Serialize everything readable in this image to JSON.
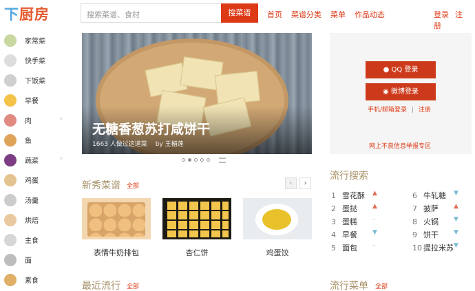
{
  "header": {
    "logo_part1": "下",
    "logo_part2": "厨房",
    "search_placeholder": "搜索菜谱、食材",
    "search_button": "搜菜谱",
    "nav": [
      "首页",
      "菜谱分类",
      "菜单",
      "作品动态"
    ],
    "login": "登录",
    "register": "注册"
  },
  "sidebar": {
    "items": [
      {
        "label": "家常菜",
        "icon": "dish-icon",
        "color": "#c9d8a0",
        "arrow": false
      },
      {
        "label": "快手菜",
        "icon": "clock-icon",
        "color": "#dddddd",
        "arrow": false
      },
      {
        "label": "下饭菜",
        "icon": "pot-icon",
        "color": "#cfcfcf",
        "arrow": false
      },
      {
        "label": "早餐",
        "icon": "sun-icon",
        "color": "#f3c34a",
        "arrow": false
      },
      {
        "label": "肉",
        "icon": "pig-icon",
        "color": "#e08a82",
        "arrow": true
      },
      {
        "label": "鱼",
        "icon": "fish-icon",
        "color": "#e0a35a",
        "arrow": false
      },
      {
        "label": "蔬菜",
        "icon": "eggplant-icon",
        "color": "#7d3d84",
        "arrow": true
      },
      {
        "label": "鸡蛋",
        "icon": "egg-icon",
        "color": "#e4c391",
        "arrow": false
      },
      {
        "label": "汤羹",
        "icon": "soup-bowl-icon",
        "color": "#cccccc",
        "arrow": false
      },
      {
        "label": "烘焙",
        "icon": "cookie-icon",
        "color": "#e8c9a0",
        "arrow": false
      },
      {
        "label": "主食",
        "icon": "rice-bowl-icon",
        "color": "#d6d6d6",
        "arrow": false
      },
      {
        "label": "面",
        "icon": "noodle-bowl-icon",
        "color": "#bdbdbd",
        "arrow": false
      },
      {
        "label": "素食",
        "icon": "wheat-icon",
        "color": "#e0b069",
        "arrow": false
      }
    ]
  },
  "hero": {
    "title": "无糖香葱苏打咸饼干",
    "made_count": "1663 人做过这道菜",
    "author": "by 王楣莲",
    "slide_count": 5,
    "active_slide": 2
  },
  "new_recipes": {
    "title": "新秀菜谱",
    "all_link": "全部",
    "prev": "‹",
    "next": "›",
    "items": [
      {
        "caption": "表情牛奶排包"
      },
      {
        "caption": "杏仁饼"
      },
      {
        "caption": "鸡蛋饺"
      }
    ]
  },
  "recent": {
    "title": "最近流行",
    "all_link": "全部"
  },
  "login_panel": {
    "qq_login": "QQ 登录",
    "weibo_login": "微博登录",
    "phone_login": "手机/邮箱登录",
    "separator": "|",
    "register": "注册",
    "report": "网上不良信息举报专区"
  },
  "hot_search": {
    "title": "流行搜索",
    "items": [
      {
        "rank": "1",
        "term": "雪花酥",
        "trend": "up"
      },
      {
        "rank": "2",
        "term": "蛋挞",
        "trend": "up"
      },
      {
        "rank": "3",
        "term": "蛋糕",
        "trend": "flat"
      },
      {
        "rank": "4",
        "term": "早餐",
        "trend": "down"
      },
      {
        "rank": "5",
        "term": "面包",
        "trend": "flat"
      },
      {
        "rank": "6",
        "term": "牛轧糖",
        "trend": "down"
      },
      {
        "rank": "7",
        "term": "披萨",
        "trend": "up"
      },
      {
        "rank": "8",
        "term": "火锅",
        "trend": "down"
      },
      {
        "rank": "9",
        "term": "饼干",
        "trend": "down"
      },
      {
        "rank": "10",
        "term": "提拉米苏",
        "trend": "down"
      }
    ]
  },
  "hot_menus": {
    "title": "流行菜单",
    "all_link": "全部"
  },
  "trend_icons": {
    "up": "▲",
    "down": "▼",
    "flat": "–"
  }
}
